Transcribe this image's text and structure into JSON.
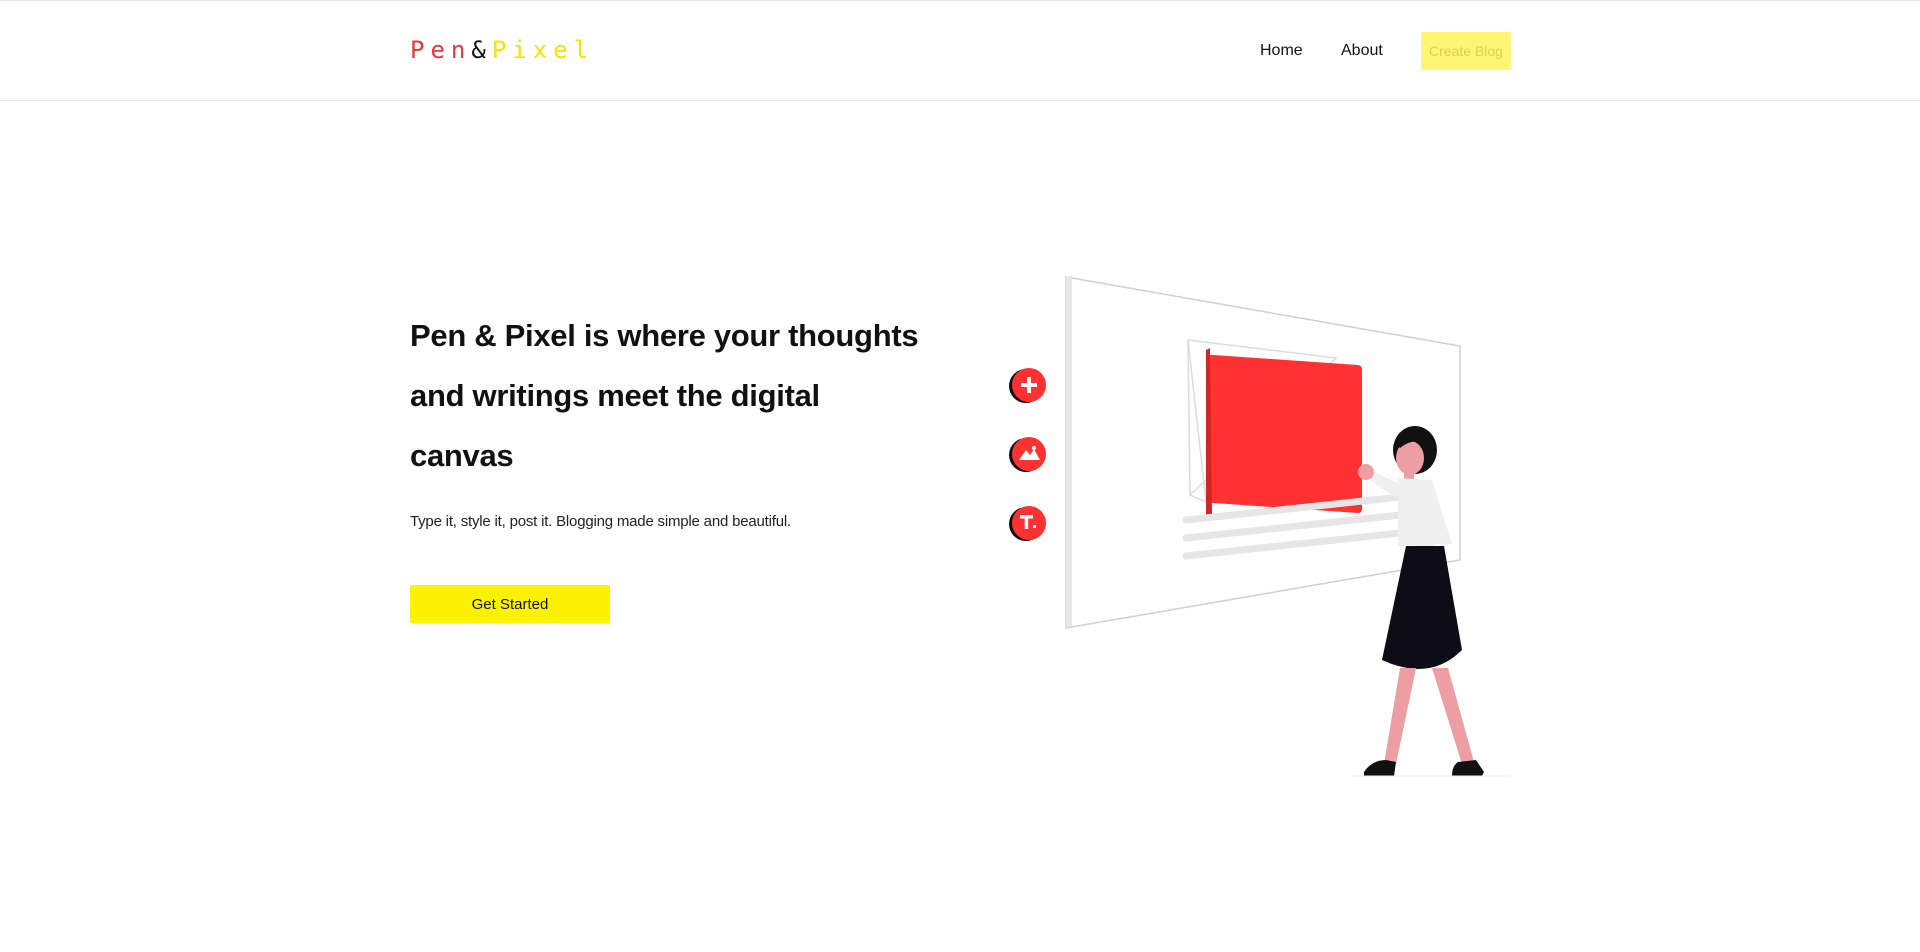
{
  "header": {
    "logo": {
      "pen": "Pen",
      "amp": "&",
      "pixel": "Pixel"
    },
    "nav": {
      "home_label": "Home",
      "about_label": "About",
      "create_label": "Create Blog"
    }
  },
  "hero": {
    "title": "Pen & Pixel is where your thoughts and writings meet the digital canvas",
    "subtitle": "Type it, style it, post it. Blogging made simple and beautiful.",
    "cta_label": "Get Started"
  },
  "illustration": {
    "icons": [
      "plus-icon",
      "image-icon",
      "text-icon"
    ]
  },
  "colors": {
    "accent_red": "#ff3131",
    "accent_yellow": "#fcf200",
    "button_disabled_yellow": "#fdf573",
    "text": "#111111"
  }
}
